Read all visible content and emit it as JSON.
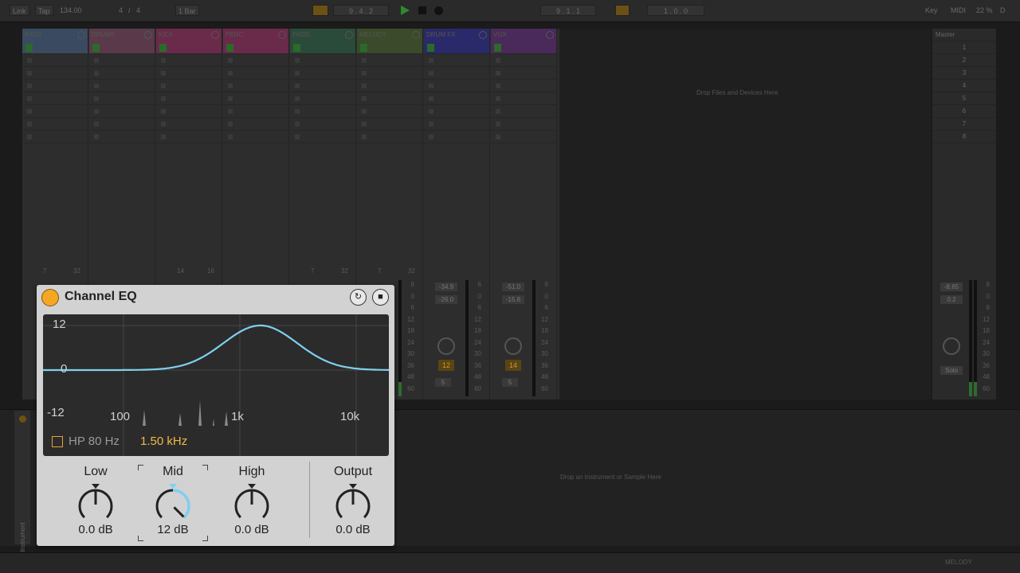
{
  "transport": {
    "link": "Link",
    "tap": "Tap",
    "tempo": "134.00",
    "signature_num": "4",
    "signature_sep": "/",
    "signature_den": "4",
    "quantize": "1 Bar",
    "position": "9 . 4 . 2",
    "loop_start": "9 . 1 . 1",
    "loop_length": "1 . 0 . 0",
    "key": "Key",
    "midi": "MIDI",
    "cpu": "22 %",
    "d": "D"
  },
  "tracks": [
    {
      "name": "BASS",
      "color": "#3a4a60"
    },
    {
      "name": "DRUMS",
      "color": "#5a3a4a"
    },
    {
      "name": "KICK",
      "color": "#6a2a4a"
    },
    {
      "name": "PERC",
      "color": "#6a2a4a"
    },
    {
      "name": "PADS",
      "color": "#2a4a3a"
    },
    {
      "name": "MELODY",
      "color": "#3a4a2a"
    },
    {
      "name": "DRUM FX",
      "color": "#2a2a6a"
    },
    {
      "name": "VOX",
      "color": "#4a2a5a"
    }
  ],
  "mixer": {
    "sends": [
      {
        "a": "7",
        "b": "32"
      },
      {
        "a": "",
        "b": ""
      },
      {
        "a": "14",
        "b": "16"
      },
      {
        "a": "",
        "b": ""
      },
      {
        "a": "7",
        "b": "32"
      },
      {
        "a": "7",
        "b": "32"
      }
    ],
    "drumfx_vol": "-34.9",
    "drumfx_peak": "-26.0",
    "drumfx_num": "12",
    "drumfx_small": "5",
    "vox_vol": "-51.0",
    "vox_peak": "-15.8",
    "vox_num": "14",
    "vox_small": "5",
    "master_vol": "-8.65",
    "master_peak": "0.2",
    "master_solo": "Solo",
    "scale": [
      "6",
      "0",
      "6",
      "12",
      "18",
      "24",
      "30",
      "36",
      "48",
      "60"
    ]
  },
  "master": {
    "title": "Master",
    "scenes": [
      "1",
      "2",
      "3",
      "4",
      "5",
      "6",
      "7",
      "8"
    ]
  },
  "session_drop_text": "Drop Files and Devices Here",
  "detail_drop_text": "Drop an Instrument or Sample Here",
  "detail_strip_label": "Instrument",
  "bottom_track": "MELODY",
  "device": {
    "name": "Channel EQ",
    "power_color": "#f5a623",
    "graph": {
      "y_labels": [
        "12",
        "0",
        "-12"
      ],
      "x_labels": [
        "100",
        "1k",
        "10k"
      ],
      "curve_color": "#7fd0f0",
      "hp_label": "HP 80 Hz",
      "hp_checked": false,
      "freq": "1.50 kHz"
    },
    "knobs": [
      {
        "label": "Low",
        "value": "0.0 dB",
        "level": 0.5
      },
      {
        "label": "Mid",
        "value": "12 dB",
        "level": 1.0
      },
      {
        "label": "High",
        "value": "0.0 dB",
        "level": 0.5
      },
      {
        "label": "Output",
        "value": "0.0 dB",
        "level": 0.5
      }
    ]
  }
}
